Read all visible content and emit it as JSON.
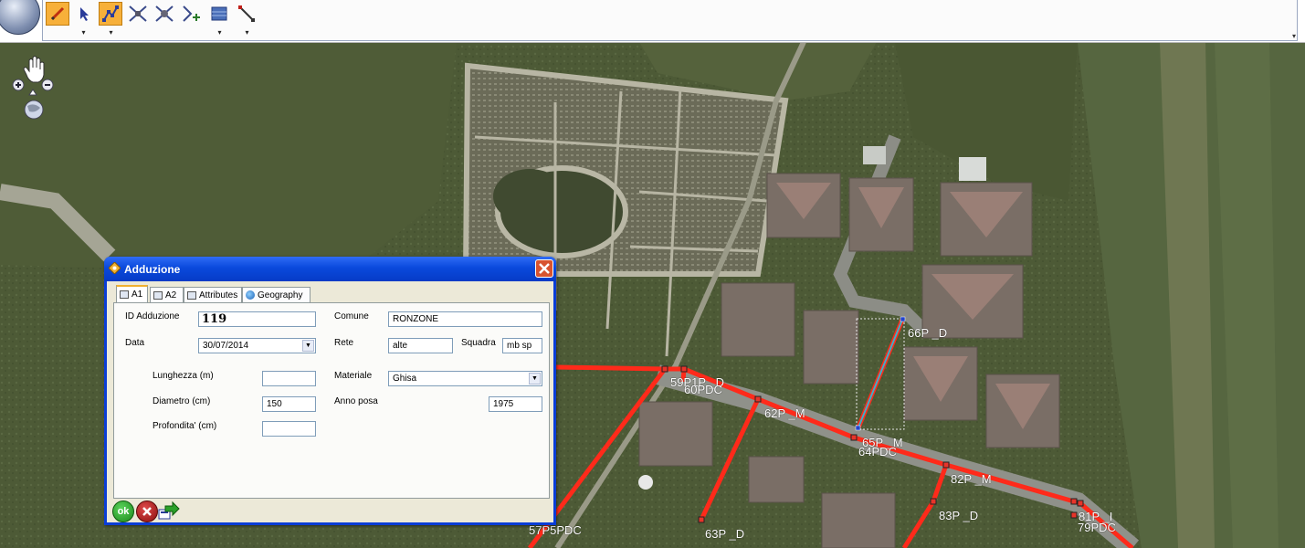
{
  "toolbar": {
    "tools": [
      "app-menu",
      "pencil-edit",
      "select-arrow",
      "vertex-edit",
      "split-feature",
      "merge-feature",
      "add-node",
      "layer-raster",
      "snap-line"
    ]
  },
  "map": {
    "labels": [
      {
        "text": "66P _D"
      },
      {
        "text": "59P1P _D"
      },
      {
        "text": "60PDC"
      },
      {
        "text": "62P _M"
      },
      {
        "text": "65P _M"
      },
      {
        "text": "64PDC"
      },
      {
        "text": "82P _M"
      },
      {
        "text": "83P _D"
      },
      {
        "text": "63P _D"
      },
      {
        "text": "81P _I"
      },
      {
        "text": "79PDC"
      },
      {
        "text": "57P5PDC"
      }
    ],
    "network_color": "#ff2a1a",
    "selected_color": "#3fb0c8"
  },
  "dialog": {
    "title": "Adduzione",
    "tabs": [
      {
        "label": "A1"
      },
      {
        "label": "A2"
      },
      {
        "label": "Attributes"
      },
      {
        "label": "Geography"
      }
    ],
    "fields": {
      "id_adduzione": {
        "label": "ID Adduzione",
        "value": "119"
      },
      "comune": {
        "label": "Comune",
        "value": "RONZONE"
      },
      "data": {
        "label": "Data",
        "value": "30/07/2014"
      },
      "rete": {
        "label": "Rete",
        "value": "alte"
      },
      "squadra": {
        "label": "Squadra",
        "value": "mb sp"
      },
      "lunghezza": {
        "label": "Lunghezza (m)",
        "value": ""
      },
      "materiale": {
        "label": "Materiale",
        "value": "Ghisa"
      },
      "diametro": {
        "label": "Diametro (cm)",
        "value": "150"
      },
      "anno_posa": {
        "label": "Anno posa",
        "value": "1975"
      },
      "profondita": {
        "label": "Profondita' (cm)",
        "value": ""
      }
    },
    "actions": {
      "ok": "ok"
    }
  }
}
